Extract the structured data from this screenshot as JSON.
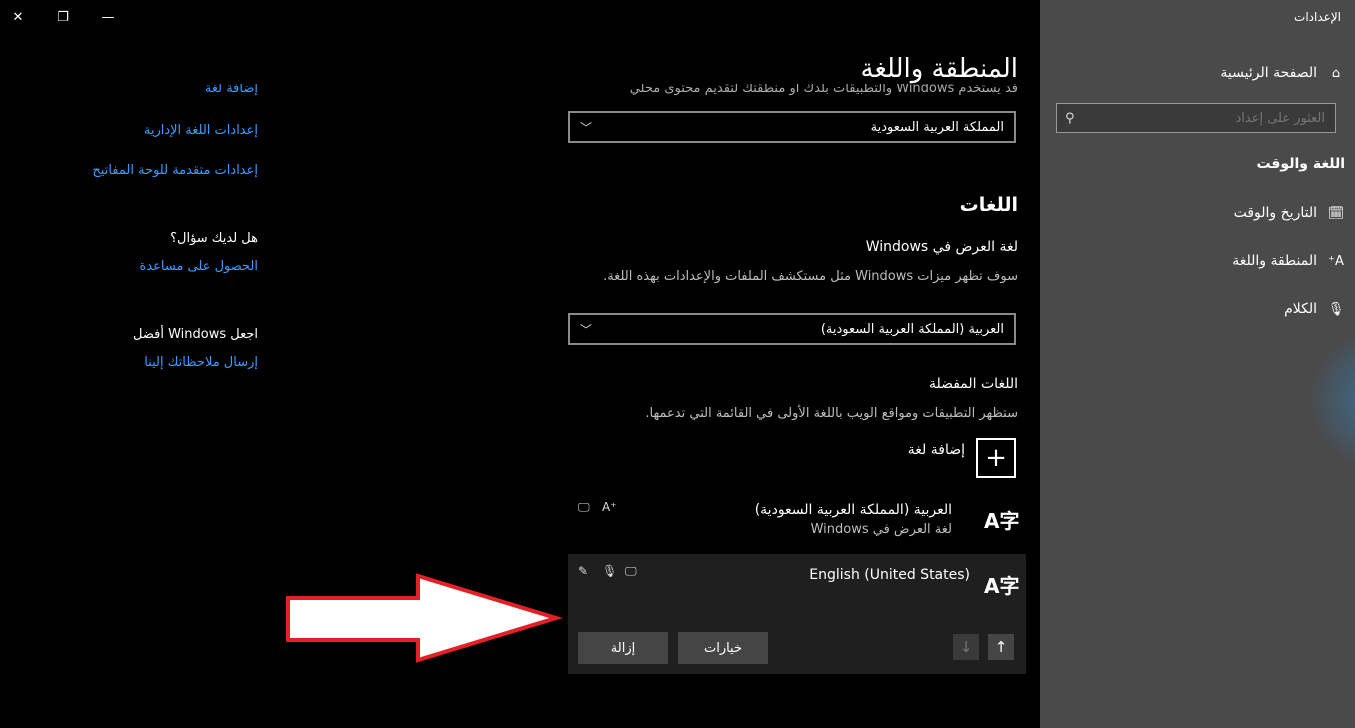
{
  "window": {
    "title": "الإعدادات",
    "close_icon": "✕",
    "restore_icon": "❐",
    "minimize_icon": "—"
  },
  "nav": {
    "home_label": "الصفحة الرئيسية",
    "search_placeholder": "العثور على إعداد",
    "section_title": "اللغة والوقت",
    "items": [
      {
        "label": "التاريخ والوقت"
      },
      {
        "label": "المنطقة واللغة"
      },
      {
        "label": "الكلام"
      }
    ]
  },
  "main": {
    "title": "المنطقة واللغة",
    "cut_text": "قد يستخدم Windows والتطبيقات بلدك أو منطقتك لتقديم محتوى محلي",
    "country_value": "المملكة العربية السعودية",
    "languages_heading": "اللغات",
    "display_language_label": "لغة العرض في Windows",
    "display_language_desc": "سوف تظهر ميزات Windows مثل مستكشف الملفات والإعدادات بهذه اللغة.",
    "display_language_value": "العربية (المملكة العربية السعودية)",
    "preferred_label": "اللغات المفضلة",
    "preferred_desc": "ستظهر التطبيقات ومواقع الويب باللغة الأولى في القائمة التي تدعمها.",
    "add_language_label": "إضافة لغة",
    "languages": [
      {
        "name": "العربية (المملكة العربية السعودية)",
        "sub": "لغة العرض في Windows"
      },
      {
        "name": "English (United States)",
        "sub": ""
      }
    ],
    "options_button": "خيارات",
    "remove_button": "إزالة"
  },
  "side_links": {
    "cut_text": "إضافة لغة",
    "admin_language": "إعدادات اللغة الإدارية",
    "advanced_keyboard": "إعدادات متقدمة للوحة المفاتيح",
    "question_heading": "هل لديك سؤال؟",
    "get_help": "الحصول على مساعدة",
    "improve_heading": "اجعل Windows أفضل",
    "send_feedback": "إرسال ملاحظاتك إلينا"
  },
  "colors": {
    "accent_link": "#3b9cff",
    "nav_bg": "#4a4a4a",
    "annotation_arrow_border": "#e32025"
  }
}
